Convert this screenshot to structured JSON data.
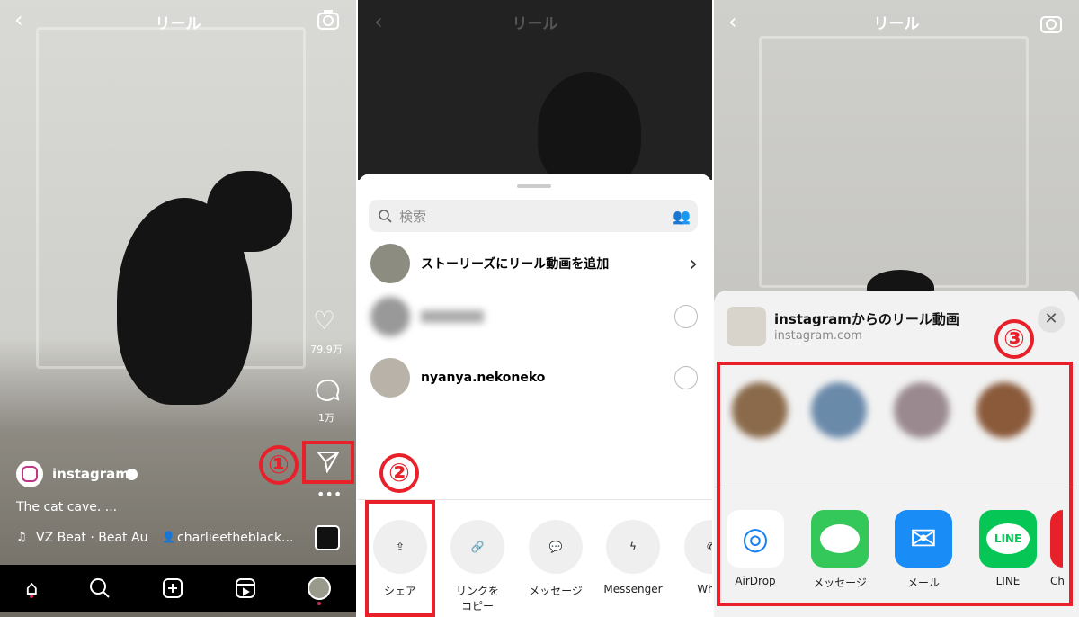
{
  "panel1": {
    "title": "リール",
    "likes": "79.9万",
    "comments": "1万",
    "account": "instagram",
    "caption": "The cat cave.  ...",
    "music": "VZ Beat · Beat Au",
    "tagged_user": "charlieetheblack...",
    "step_label": "①",
    "nav": [
      "home-icon",
      "search-icon",
      "add-icon",
      "reels-icon",
      "profile-avatar"
    ]
  },
  "panel2": {
    "title": "リール",
    "search_placeholder": "検索",
    "rows": [
      {
        "label": "ストーリーズにリール動画を追加"
      },
      {
        "label": ""
      },
      {
        "label": "nyanya.nekoneko"
      }
    ],
    "share_options": [
      "シェア",
      "リンクを\nコピー",
      "メッセージ",
      "Messenger",
      "What"
    ],
    "step_label": "②"
  },
  "panel3": {
    "title": "リール",
    "share_title": "instagramからのリール動画",
    "share_domain": "instagram.com",
    "apps": [
      "AirDrop",
      "メッセージ",
      "メール",
      "LINE",
      "Ch"
    ],
    "line_logo": "LINE",
    "step_label": "③"
  },
  "colors": {
    "highlight": "#e8202a",
    "line_green": "#06c755",
    "messages_green": "#34c759",
    "mail_blue": "#1a8cf5"
  }
}
